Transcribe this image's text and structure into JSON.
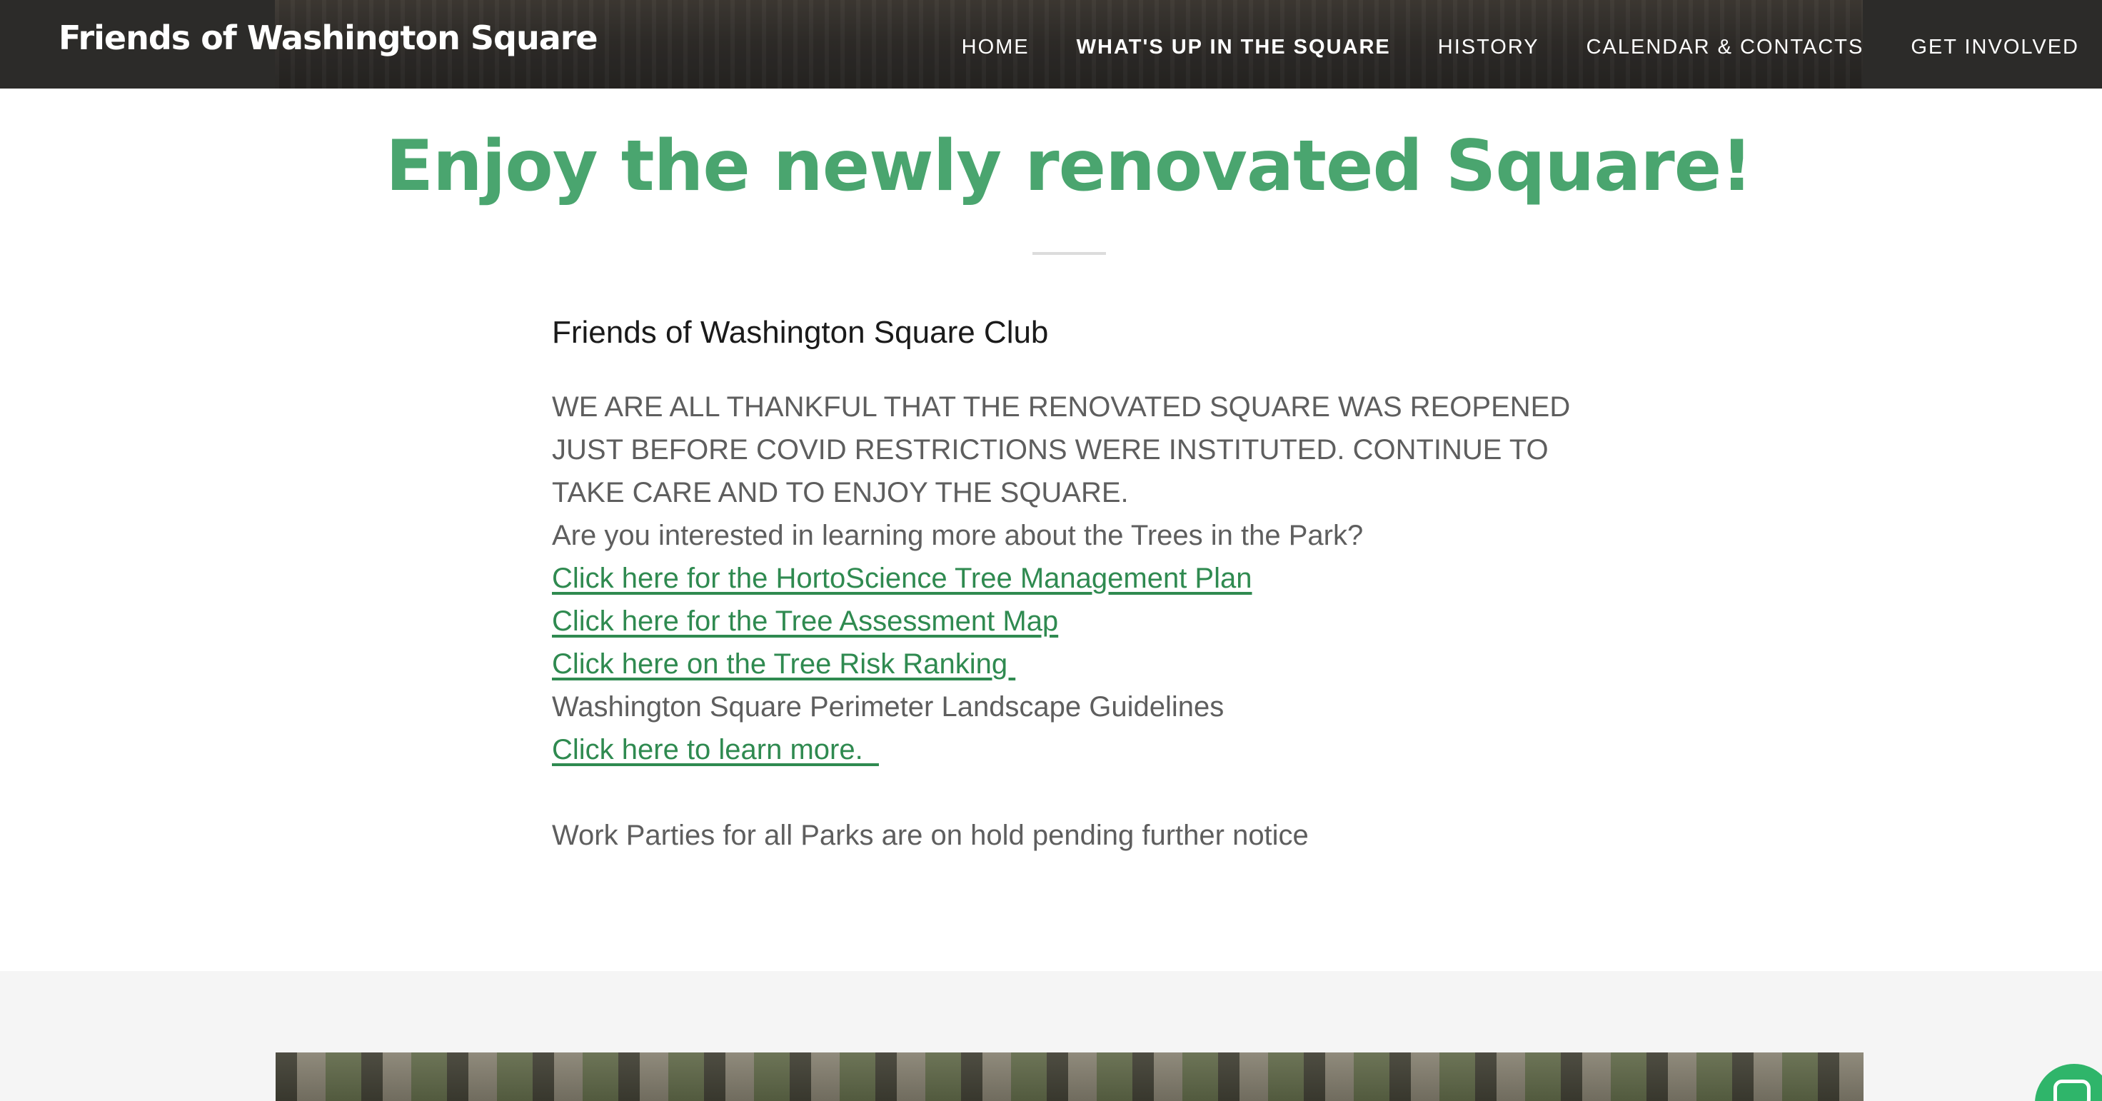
{
  "header": {
    "site_title": "Friends of Washington Square",
    "nav": [
      {
        "label": "HOME",
        "active": false
      },
      {
        "label": "WHAT'S UP IN THE SQUARE",
        "active": true
      },
      {
        "label": "HISTORY",
        "active": false
      },
      {
        "label": "CALENDAR & CONTACTS",
        "active": false
      },
      {
        "label": "GET INVOLVED",
        "active": false
      }
    ]
  },
  "main": {
    "title": "Enjoy the newly renovated Square!",
    "club_heading": "Friends of Washington Square Club",
    "announcement_lines": [
      "WE ARE ALL THANKFUL THAT THE RENOVATED SQUARE WAS REOPENED",
      "JUST BEFORE COVID RESTRICTIONS WERE INSTITUTED. CONTINUE TO",
      "TAKE CARE AND TO ENJOY THE SQUARE."
    ],
    "trees_question": "Are you interested in learning more about the Trees in the Park?",
    "links": {
      "tree_management": "Click here for the HortoScience Tree Management Plan",
      "tree_assessment": "Click here for the Tree Assessment Map",
      "tree_risk": "Click here on the Tree Risk Ranking "
    },
    "landscape_guidelines": "Washington Square Perimeter Landscape Guidelines",
    "learn_more": "Click here to learn more.  ",
    "work_parties": "Work Parties for all Parks are on hold pending further notice"
  },
  "colors": {
    "accent_green": "#4aa56f",
    "link_green": "#2f8a50",
    "header_bg": "#3a3835"
  },
  "icons": {
    "chat": "chat-bubble-icon"
  }
}
